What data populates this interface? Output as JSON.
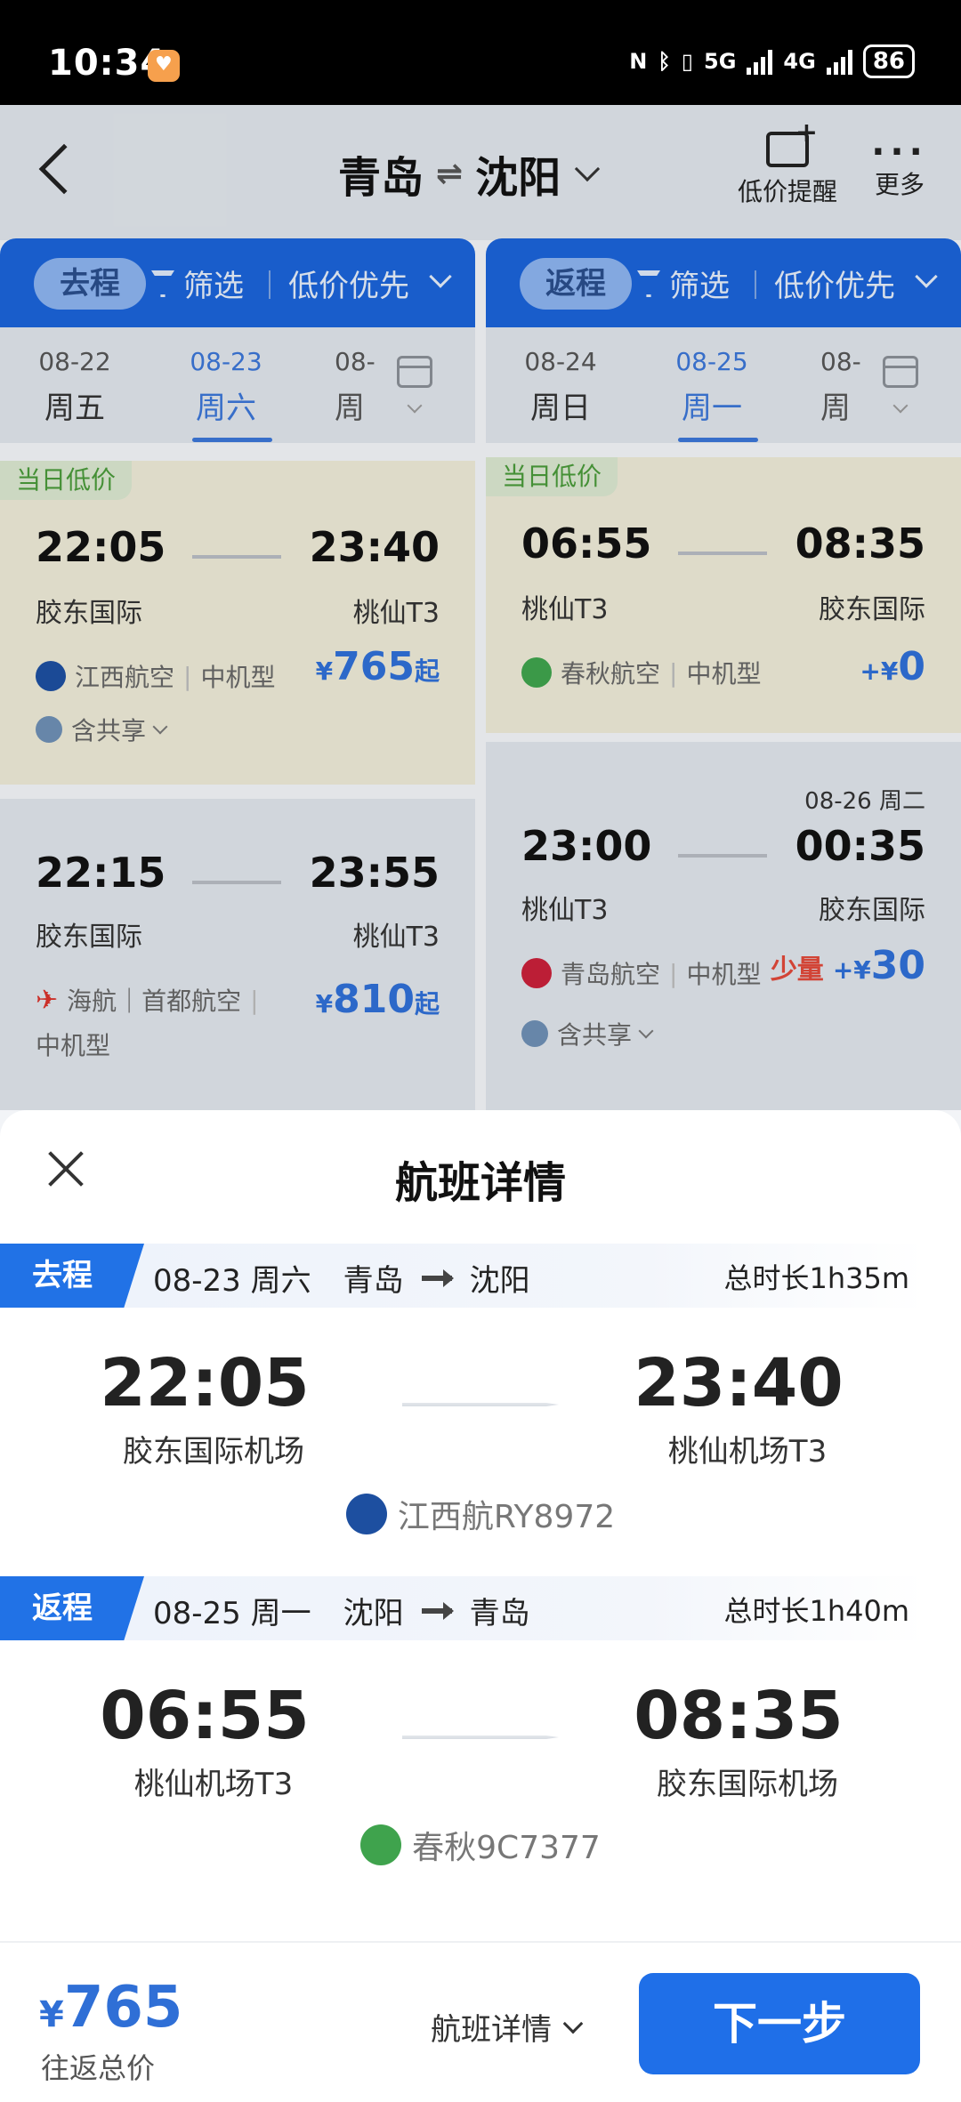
{
  "status_bar": {
    "time": "10:34",
    "network1": "5G",
    "network2": "4G",
    "battery": "86"
  },
  "header": {
    "origin": "青岛",
    "swap_symbol": "⇌",
    "destination": "沈阳",
    "low_price_alert_label": "低价提醒",
    "more_label": "更多"
  },
  "outbound": {
    "direction_label": "去程",
    "filter_label": "筛选",
    "sort_label": "低价优先",
    "dates": [
      {
        "date": "08-22",
        "weekday": "周五"
      },
      {
        "date": "08-23",
        "weekday": "周六"
      },
      {
        "date": "08-",
        "weekday": "周"
      }
    ],
    "flights": [
      {
        "tag": "当日低价",
        "dep_time": "22:05",
        "arr_time": "23:40",
        "dep_airport": "胶东国际",
        "arr_airport": "桃仙T3",
        "airline": "江西航空",
        "aircraft": "中机型",
        "price_currency": "¥",
        "price": "765",
        "price_suffix": "起",
        "share_label": "含共享"
      },
      {
        "dep_time": "22:15",
        "arr_time": "23:55",
        "dep_airport": "胶东国际",
        "arr_airport": "桃仙T3",
        "airline": "海航｜首都航空",
        "aircraft": "中机型",
        "price_currency": "¥",
        "price": "810",
        "price_suffix": "起"
      }
    ]
  },
  "return": {
    "direction_label": "返程",
    "filter_label": "筛选",
    "sort_label": "低价优先",
    "dates": [
      {
        "date": "08-24",
        "weekday": "周日"
      },
      {
        "date": "08-25",
        "weekday": "周一"
      },
      {
        "date": "08-",
        "weekday": "周"
      }
    ],
    "flights": [
      {
        "tag": "当日低价",
        "dep_time": "06:55",
        "arr_time": "08:35",
        "dep_airport": "桃仙T3",
        "arr_airport": "胶东国际",
        "airline": "春秋航空",
        "aircraft": "中机型",
        "price_prefix": "+¥",
        "price": "0"
      },
      {
        "next_day": "08-26 周二",
        "dep_time": "23:00",
        "arr_time": "00:35",
        "dep_airport": "桃仙T3",
        "arr_airport": "胶东国际",
        "airline": "青岛航空",
        "aircraft": "中机型",
        "availability": "少量",
        "price_prefix": "+¥",
        "price": "30",
        "share_label": "含共享"
      }
    ]
  },
  "sheet": {
    "title": "航班详情",
    "segments": [
      {
        "label": "去程",
        "date": "08-23 周六",
        "from": "青岛",
        "to": "沈阳",
        "duration": "总时长1h35m",
        "dep_time": "22:05",
        "arr_time": "23:40",
        "dep_airport": "胶东国际机场",
        "arr_airport": "桃仙机场T3",
        "flight_no": "江西航RY8972"
      },
      {
        "label": "返程",
        "date": "08-25 周一",
        "from": "沈阳",
        "to": "青岛",
        "duration": "总时长1h40m",
        "dep_time": "06:55",
        "arr_time": "08:35",
        "dep_airport": "桃仙机场T3",
        "arr_airport": "胶东国际机场",
        "flight_no": "春秋9C7377"
      }
    ],
    "bottom": {
      "currency": "¥",
      "total_price": "765",
      "total_label": "往返总价",
      "detail_toggle": "航班详情",
      "next_button": "下一步"
    }
  },
  "colors": {
    "primary": "#1f6fe8",
    "price": "#2f6fd6",
    "low_tag": "#4a9a3a",
    "few": "#e0493a"
  },
  "icons": [
    "back-icon",
    "low-price-alert-icon",
    "more-dots-icon",
    "filter-icon",
    "calendar-icon",
    "close-icon",
    "jiangxi-air-logo-icon",
    "spring-airlines-logo-icon",
    "hainan-airlines-logo-icon",
    "qingdao-airlines-logo-icon",
    "codeshare-icon",
    "chevron-down-icon"
  ]
}
